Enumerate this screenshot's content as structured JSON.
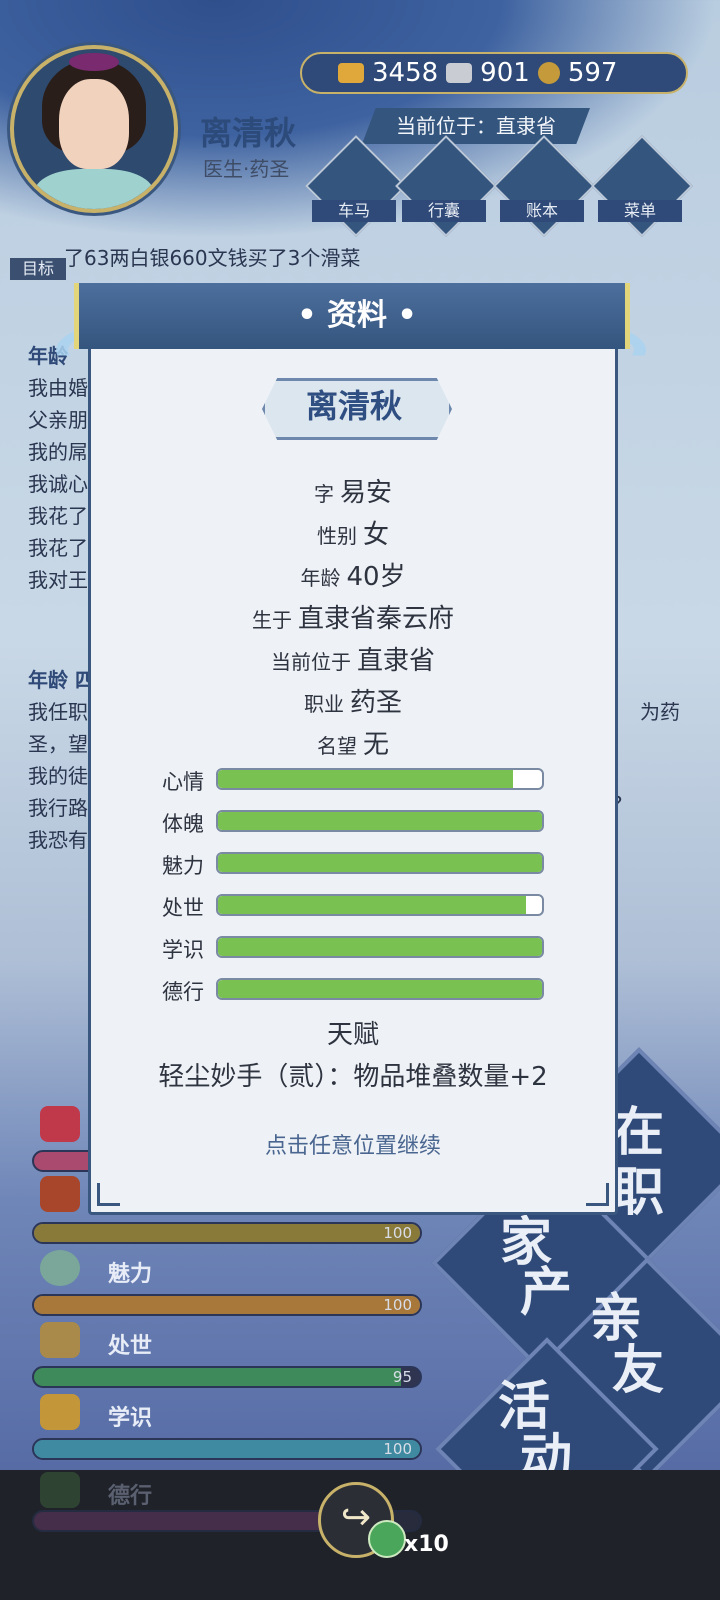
{
  "character": {
    "name": "离清秋",
    "title": "医生·药圣",
    "location": "当前位于：直隶省"
  },
  "currency": {
    "gold": "3458",
    "silver": "901",
    "coin": "597"
  },
  "menu": [
    {
      "label": "车马"
    },
    {
      "label": "行囊"
    },
    {
      "label": "账本"
    },
    {
      "label": "菜单"
    }
  ],
  "goal": {
    "tag": "目标",
    "text": "了63两白银660文钱买了3个滑菜"
  },
  "log": {
    "head1": "年龄",
    "lines1": [
      "我由婚",
      "父亲朋",
      "我的屌",
      "我诚心",
      "我花了",
      "我花了",
      "我对王"
    ],
    "head2": "年龄 四",
    "lines2": [
      "我任职",
      "圣，望",
      "我的徒",
      "我行路",
      "我恐有"
    ],
    "tail_right": [
      "为药",
      "?"
    ]
  },
  "stats": [
    {
      "label": "",
      "value": "",
      "fill": 0.3
    },
    {
      "label": "",
      "value": "100",
      "fill": 1.0
    },
    {
      "label": "魅力",
      "value": "100",
      "fill": 1.0
    },
    {
      "label": "处世",
      "value": "95",
      "fill": 0.95
    },
    {
      "label": "学识",
      "value": "100",
      "fill": 1.0
    },
    {
      "label": "德行",
      "value": "",
      "fill": 0.9
    }
  ],
  "big_buttons": {
    "a": "在",
    "a2": "职",
    "b": "家",
    "b2": "产",
    "c": "亲",
    "c2": "友",
    "d": "活",
    "d2": "动"
  },
  "bottom": {
    "token_count": "x10",
    "share_icon": "share-icon"
  },
  "modal": {
    "title": "• 资料 •",
    "name": "离清秋",
    "info": [
      {
        "key": "字",
        "value": "易安"
      },
      {
        "key": "性别",
        "value": "女"
      },
      {
        "key": "年龄",
        "value": "40岁"
      },
      {
        "key": "生于",
        "value": "直隶省秦云府"
      },
      {
        "key": "当前位于",
        "value": "直隶省"
      },
      {
        "key": "职业",
        "value": "药圣"
      },
      {
        "key": "名望",
        "value": "无"
      }
    ],
    "attributes": [
      {
        "label": "心情",
        "fill": 0.91
      },
      {
        "label": "体魄",
        "fill": 1.0
      },
      {
        "label": "魅力",
        "fill": 1.0
      },
      {
        "label": "处世",
        "fill": 0.95
      },
      {
        "label": "学识",
        "fill": 1.0
      },
      {
        "label": "德行",
        "fill": 1.0
      }
    ],
    "talent_heading": "天赋",
    "talent_desc": "轻尘妙手（贰）：物品堆叠数量+2",
    "continue_hint": "点击任意位置继续"
  },
  "colors": {
    "bar_green": "#79c150",
    "panel_blue": "#34557d",
    "gold_trim": "#c8b26a"
  }
}
